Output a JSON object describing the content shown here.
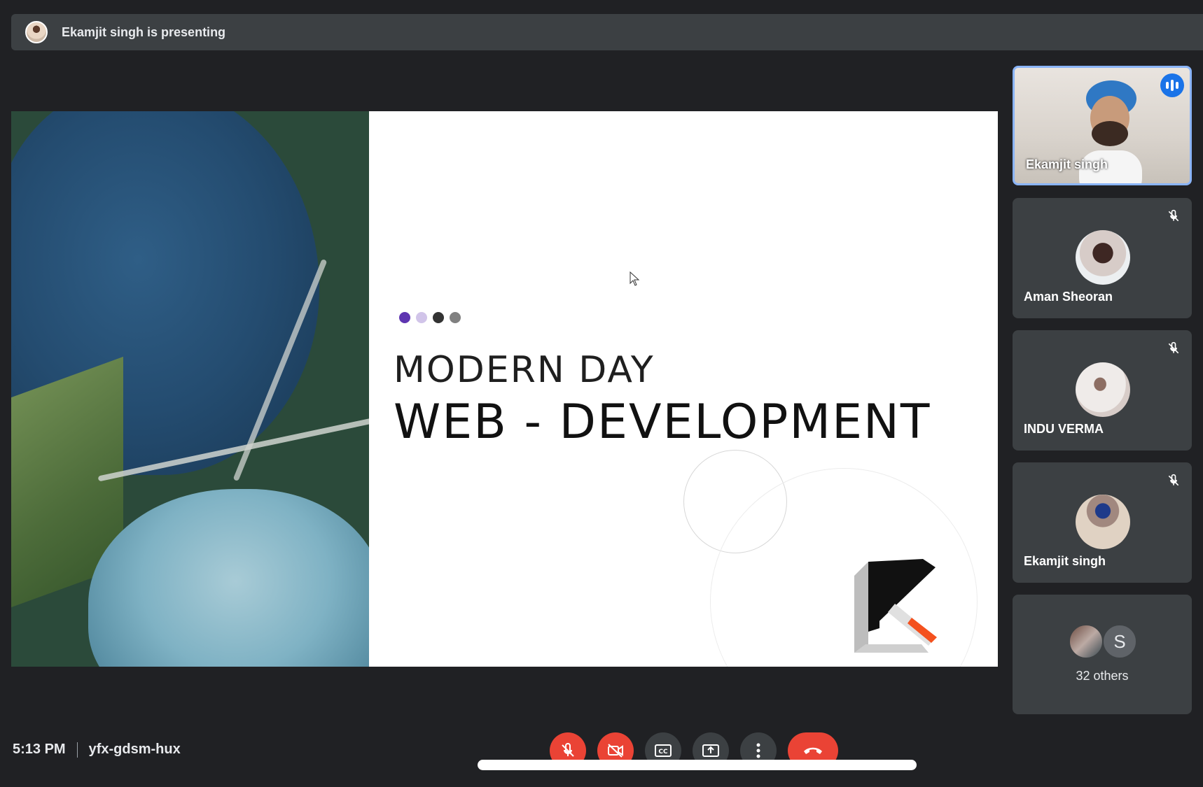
{
  "banner": {
    "text": "Ekamjit singh is presenting"
  },
  "slide": {
    "title_line1": "MODERN DAY",
    "title_line2": "WEB - DEVELOPMENT",
    "dot_colors": [
      "#5e35b1",
      "#d1c4e9",
      "#333333",
      "#808080"
    ]
  },
  "participants": [
    {
      "name": "Ekamjit singh",
      "speaking": true
    },
    {
      "name": "Aman Sheoran",
      "muted": true
    },
    {
      "name": "INDU VERMA",
      "muted": true
    },
    {
      "name": "Ekamjit singh",
      "muted": true
    }
  ],
  "others": {
    "initial": "S",
    "label": "32 others"
  },
  "meeting": {
    "time": "5:13 PM",
    "code": "yfx-gdsm-hux"
  },
  "controls": [
    {
      "icon": "mic-off-icon"
    },
    {
      "icon": "camera-off-icon"
    },
    {
      "icon": "closed-captions-icon"
    },
    {
      "icon": "present-screen-icon"
    },
    {
      "icon": "more-options-icon"
    },
    {
      "icon": "end-call-icon"
    }
  ],
  "colors": {
    "background": "#202124",
    "tile": "#3c4043",
    "accent": "#8ab4f8",
    "danger": "#ea4335",
    "speaking": "#1a73e8"
  }
}
